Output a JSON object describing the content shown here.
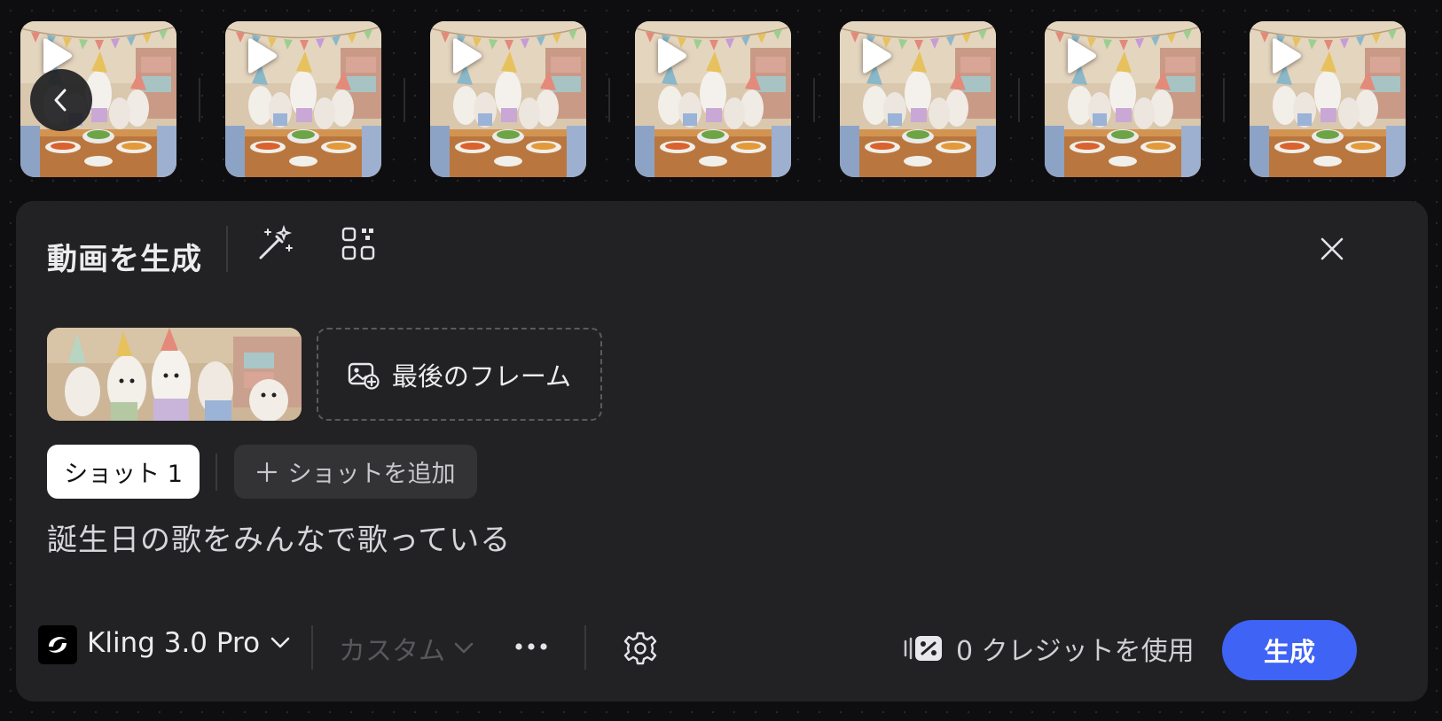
{
  "thumbnails": {
    "count": 7,
    "item_alt": "birthday-party-ermines-thumbnail",
    "play_icon": "play-icon",
    "back_icon": "chevron-left-icon"
  },
  "panel": {
    "title": "動画を生成",
    "magic_icon": "magic-wand-icon",
    "qr_icon": "qr-code-icon",
    "close_icon": "close-icon"
  },
  "frames": {
    "first_frame_icon": "image-thumbnail",
    "last_frame_label": "最後のフレーム",
    "last_frame_icon": "add-image-icon"
  },
  "shots": {
    "active_tab": "ショット 1",
    "add_label": "ショットを追加",
    "add_icon": "plus-icon"
  },
  "prompt": {
    "text": "誕生日の歌をみんなで歌っている"
  },
  "footer": {
    "model_name": "Kling 3.0 Pro",
    "custom_label": "カスタム",
    "credits_text": "0 クレジットを使用",
    "generate_label": "生成"
  },
  "colors": {
    "accent": "#3f63f5",
    "panel_bg": "#222224",
    "page_bg": "#0e0e10"
  }
}
